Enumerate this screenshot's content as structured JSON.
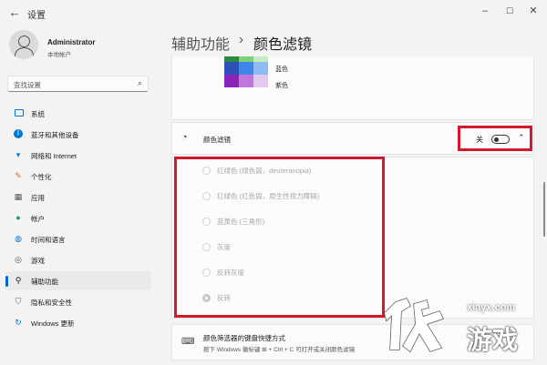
{
  "window": {
    "title": "设置",
    "controls": [
      "–",
      "☐",
      "✕"
    ]
  },
  "user": {
    "name": "Administrator",
    "subtitle": "本地帐户"
  },
  "search": {
    "placeholder": "查找设置"
  },
  "sidebar": {
    "items": [
      {
        "label": "系统",
        "icon": "monitor-icon",
        "color": "#0078d4"
      },
      {
        "label": "蓝牙和其他设备",
        "icon": "bluetooth-icon",
        "color": "#0078d4"
      },
      {
        "label": "网络和 Internet",
        "icon": "wifi-icon",
        "color": "#0078d4"
      },
      {
        "label": "个性化",
        "icon": "brush-icon",
        "color": "#c47b00"
      },
      {
        "label": "应用",
        "icon": "apps-icon",
        "color": "#555555"
      },
      {
        "label": "帐户",
        "icon": "person-icon",
        "color": "#1a9c5a"
      },
      {
        "label": "时间和语言",
        "icon": "globe-clock-icon",
        "color": "#0078d4"
      },
      {
        "label": "游戏",
        "icon": "gamepad-icon",
        "color": "#555555"
      },
      {
        "label": "辅助功能",
        "icon": "accessibility-icon",
        "color": "#1b1b1b"
      },
      {
        "label": "隐私和安全性",
        "icon": "shield-icon",
        "color": "#555555"
      },
      {
        "label": "Windows 更新",
        "icon": "update-icon",
        "color": "#0078d4"
      }
    ],
    "selected_index": 8
  },
  "breadcrumb": {
    "parent": "辅助功能",
    "separator": "›",
    "current": "颜色滤镜"
  },
  "palette": {
    "labels": [
      "蓝色",
      "紫色"
    ],
    "colors": [
      "#2b8a3e",
      "#7fd07a",
      "#c5ecc0",
      "#2f4fb8",
      "#3f86e8",
      "#8fbaf2",
      "#8a24b8",
      "#c276da",
      "#e3c9f0"
    ]
  },
  "color_filter": {
    "label": "颜色滤镜",
    "state": "关",
    "options": [
      "红绿色 (绿色弱，deuteranopia)",
      "红绿色 (红色弱，原生性视力障碍)",
      "蓝黄色 (三角形)",
      "灰度",
      "反转灰度",
      "反转"
    ],
    "selected_option_index": 5
  },
  "shortcut": {
    "title": "颜色筛选器的键盘快捷方式",
    "description": "按下 Windows 徽标键 ⊞ + Ctrl + C 可打开或关闭颜色滤镜"
  },
  "watermark": {
    "site": "xiayx.com",
    "brand": "游戏"
  },
  "accent_color": "#0067c0",
  "highlight_color": "#d0192a"
}
